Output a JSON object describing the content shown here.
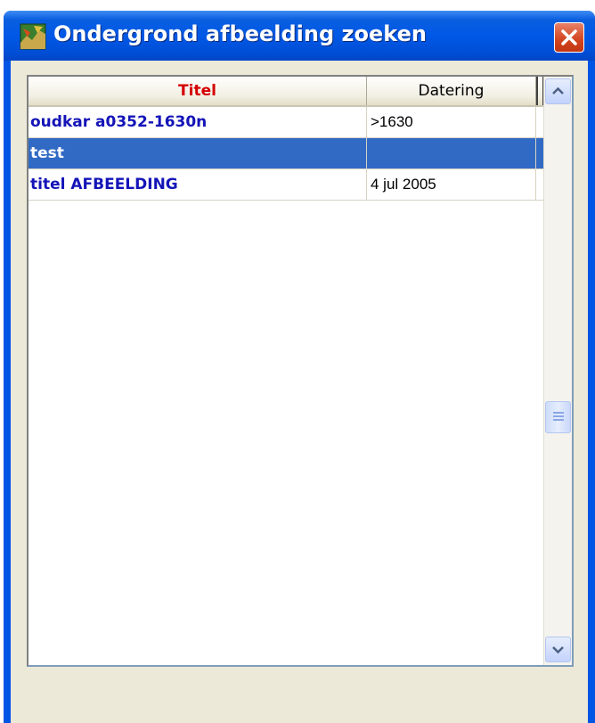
{
  "window": {
    "title": "Ondergrond afbeelding zoeken"
  },
  "table": {
    "columns": [
      "Titel",
      "Datering"
    ],
    "rows": [
      {
        "titel": "oudkar a0352-1630n",
        "datering": ">1630",
        "selected": false
      },
      {
        "titel": "test",
        "datering": "",
        "selected": true
      },
      {
        "titel": "titel AFBEELDING",
        "datering": "4 jul 2005",
        "selected": false
      }
    ]
  },
  "colors": {
    "titlebar": "#0055e5",
    "selection": "#316ac5",
    "titel_text": "#1414b8",
    "titel_header": "#d40000",
    "close_button": "#d2431e"
  },
  "icons": {
    "window_icon": "map-icon",
    "close": "close-icon",
    "scroll_up": "scroll-up-icon",
    "scroll_down": "scroll-down-icon"
  }
}
